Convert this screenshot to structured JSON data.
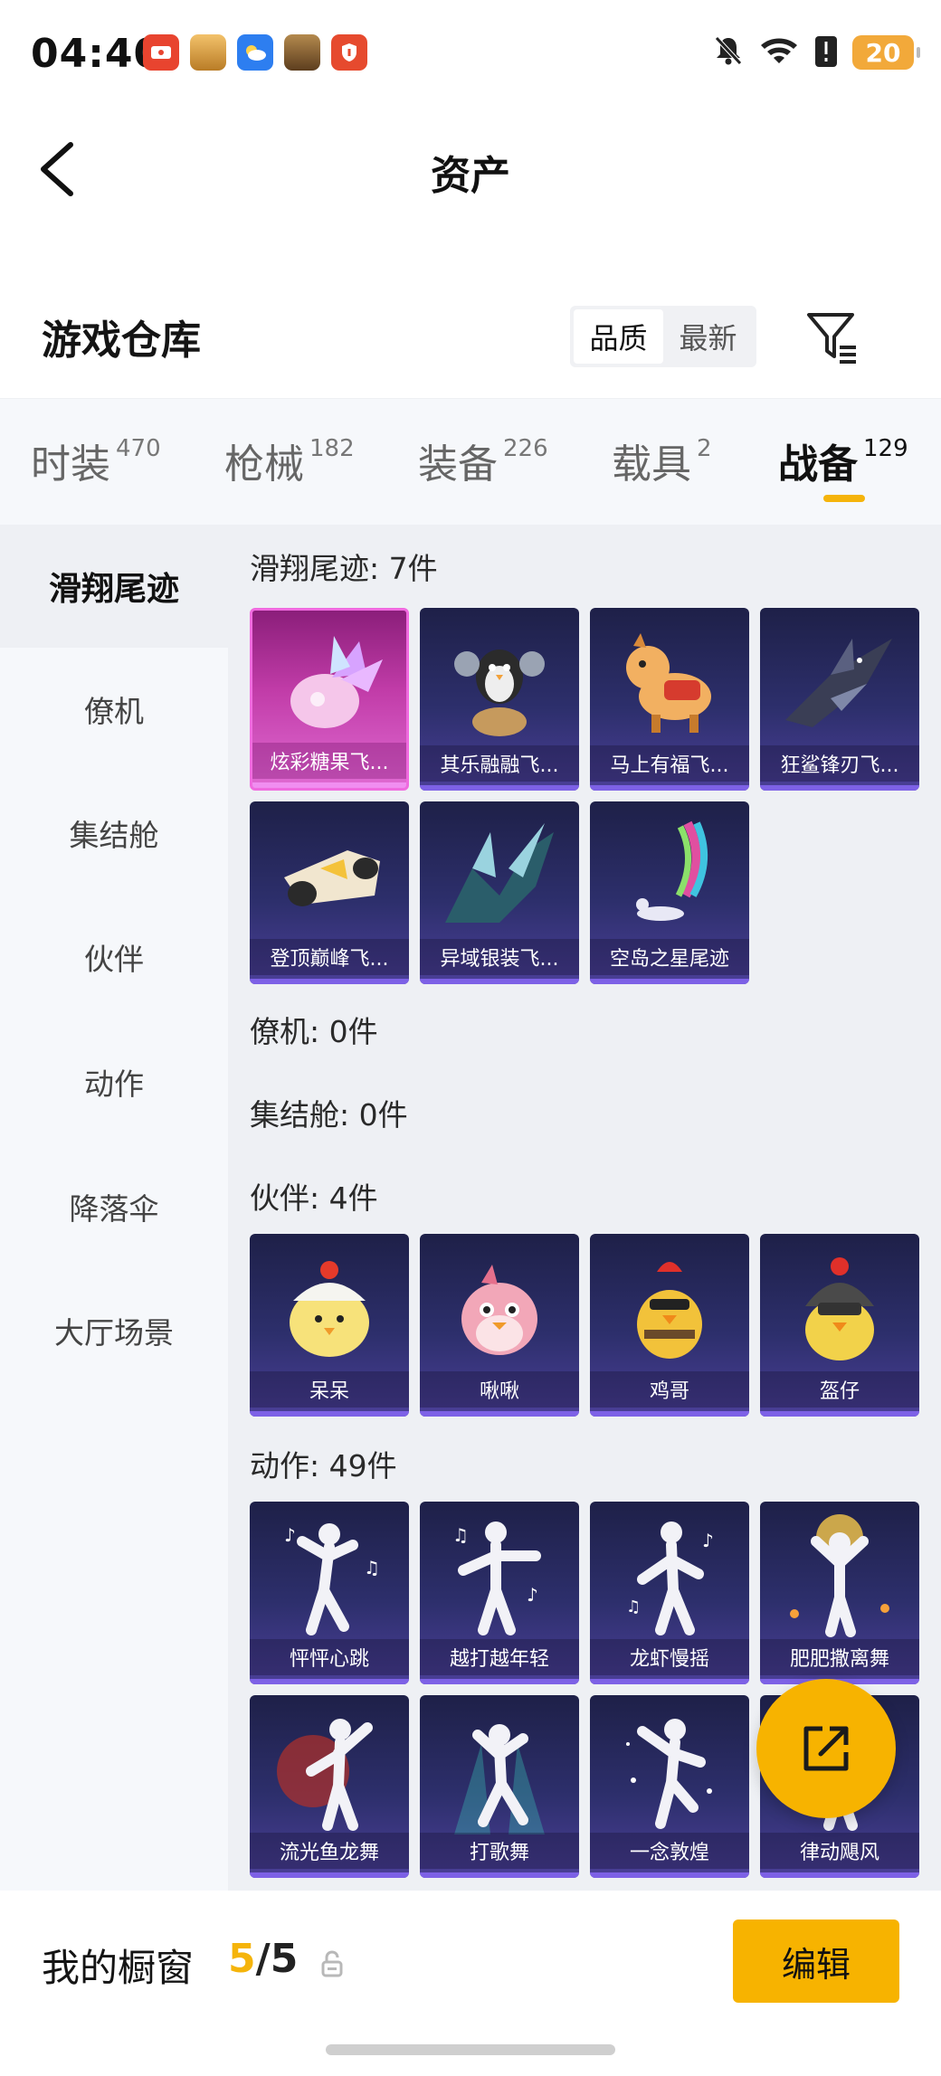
{
  "status_bar": {
    "time": "04:40",
    "battery": "20",
    "icons": [
      "bell-muted-icon",
      "wifi-icon",
      "battery-alert-icon"
    ]
  },
  "header": {
    "title": "资产"
  },
  "warehouse": {
    "title": "游戏仓库",
    "sort_options": [
      "品质",
      "最新"
    ],
    "active_sort": "品质"
  },
  "tabs": [
    {
      "label": "时装",
      "count": "470"
    },
    {
      "label": "枪械",
      "count": "182"
    },
    {
      "label": "装备",
      "count": "226"
    },
    {
      "label": "载具",
      "count": "2"
    },
    {
      "label": "战备",
      "count": "129"
    }
  ],
  "active_tab": "战备",
  "sidebar": {
    "items": [
      "滑翔尾迹",
      "僚机",
      "集结舱",
      "伙伴",
      "动作",
      "降落伞",
      "大厅场景"
    ],
    "active": "滑翔尾迹"
  },
  "sections": [
    {
      "title": "滑翔尾迹: 7件",
      "items": [
        {
          "name": "炫彩糖果飞...",
          "quality": "pink",
          "icon": "candy-glider-icon"
        },
        {
          "name": "其乐融融飞...",
          "quality": "purple",
          "icon": "penguin-glider-icon"
        },
        {
          "name": "马上有福飞...",
          "quality": "purple",
          "icon": "horse-glider-icon"
        },
        {
          "name": "狂鲨锋刃飞...",
          "quality": "purple",
          "icon": "shark-glider-icon"
        },
        {
          "name": "登顶巅峰飞...",
          "quality": "purple",
          "icon": "jet-glider-icon"
        },
        {
          "name": "异域银装飞...",
          "quality": "purple",
          "icon": "wing-glider-icon"
        },
        {
          "name": "空岛之星尾迹",
          "quality": "purple",
          "icon": "rainbow-trail-icon"
        }
      ]
    },
    {
      "title": "僚机: 0件",
      "items": []
    },
    {
      "title": "集结舱: 0件",
      "items": []
    },
    {
      "title": "伙伴: 4件",
      "items": [
        {
          "name": "呆呆",
          "quality": "purple",
          "icon": "chick-icon"
        },
        {
          "name": "啾啾",
          "quality": "purple",
          "icon": "pink-bird-icon"
        },
        {
          "name": "鸡哥",
          "quality": "purple",
          "icon": "rooster-icon"
        },
        {
          "name": "盔仔",
          "quality": "purple",
          "icon": "helmet-chick-icon"
        }
      ]
    },
    {
      "title": "动作: 49件",
      "items": [
        {
          "name": "怦怦心跳",
          "quality": "purple",
          "icon": "dance-pose-icon"
        },
        {
          "name": "越打越年轻",
          "quality": "purple",
          "icon": "dance-pose-icon"
        },
        {
          "name": "龙虾慢摇",
          "quality": "purple",
          "icon": "dance-pose-icon"
        },
        {
          "name": "肥肥撒离舞",
          "quality": "purple",
          "icon": "dance-pose-icon"
        },
        {
          "name": "流光鱼龙舞",
          "quality": "purple",
          "icon": "dance-pose-icon"
        },
        {
          "name": "打歌舞",
          "quality": "purple",
          "icon": "dance-pose-icon"
        },
        {
          "name": "一念敦煌",
          "quality": "purple",
          "icon": "dance-pose-icon"
        },
        {
          "name": "律动飓风",
          "quality": "purple",
          "icon": "dance-pose-icon"
        }
      ]
    }
  ],
  "bottom_bar": {
    "title": "我的橱窗",
    "current": "5",
    "separator": "/",
    "max": "5",
    "edit_label": "编辑"
  },
  "colors": {
    "accent": "#f7b300",
    "card_purple": "#2d2f6c",
    "card_pink": "#c13ca8"
  }
}
